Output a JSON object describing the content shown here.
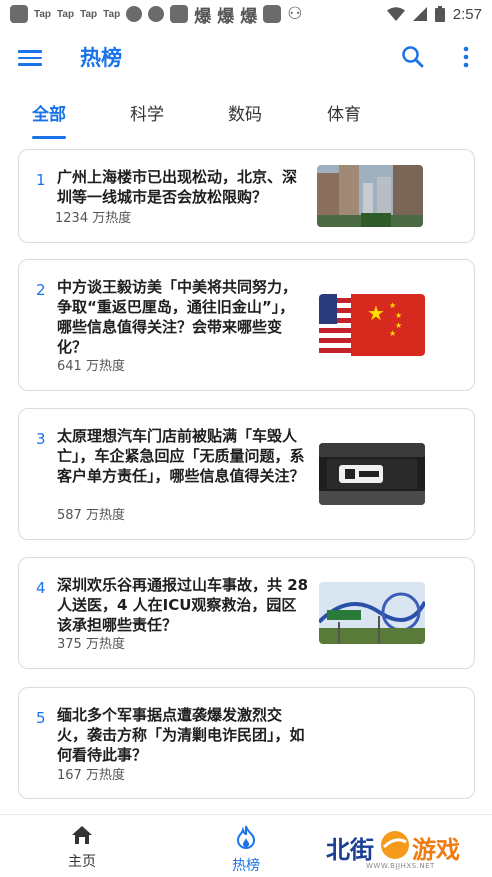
{
  "status_bar": {
    "tap_labels": [
      "Tap",
      "Tap",
      "Tap",
      "Tap"
    ],
    "glyphs": [
      "爆",
      "爆",
      "爆"
    ],
    "time": "2:57"
  },
  "app_bar": {
    "title": "热榜"
  },
  "tabs": [
    {
      "label": "全部",
      "active": true
    },
    {
      "label": "科学",
      "active": false
    },
    {
      "label": "数码",
      "active": false
    },
    {
      "label": "体育",
      "active": false
    }
  ],
  "items": [
    {
      "rank": "1",
      "title": "广州上海楼市已出现松动，北京、深圳等一线城市是否会放松限购？",
      "heat": "1234 万热度",
      "image": "city-buildings"
    },
    {
      "rank": "2",
      "title": "中方谈王毅访美「中美将共同努力，争取“重返巴厘岛，通往旧金山”」，哪些信息值得关注？会带来哪些变化？",
      "heat": "641 万热度",
      "image": "us-china-flags"
    },
    {
      "rank": "3",
      "title": "太原理想汽车门店前被贴满「车毁人亡」，车企紧急回应「无质量问题，系客户单方责任」，哪些信息值得关注？",
      "heat": "587 万热度",
      "image": "car-store-sign"
    },
    {
      "rank": "4",
      "title": "深圳欢乐谷再通报过山车事故，共 28 人送医，4 人在ICU观察救治，园区该承担哪些责任？",
      "heat": "375 万热度",
      "image": "roller-coaster"
    },
    {
      "rank": "5",
      "title": "缅北多个军事据点遭袭爆发激烈交火，袭击方称「为清剿电诈民团」，如何看待此事？",
      "heat": "167 万热度",
      "image": ""
    }
  ],
  "bottom_nav": [
    {
      "label": "主页",
      "icon": "home-icon",
      "active": false
    },
    {
      "label": "热榜",
      "icon": "flame-icon",
      "active": true
    }
  ],
  "watermark": {
    "text_a": "北街",
    "text_b": "游戏",
    "url": "WWW.BJJHXS.NET"
  },
  "colors": {
    "accent": "#1a73e8"
  }
}
